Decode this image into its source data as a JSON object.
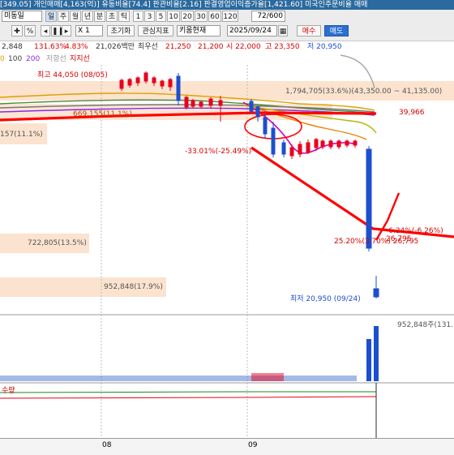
{
  "title_bar": {
    "text": "[349.05] 개인매매[4,163(억)] 유동비율[74.4] 판관비율[2.16] 판결영업이익증가율[1,421.60] 미국인주문비율 매매"
  },
  "toolbar": {
    "row1": {
      "stock_name": "미동일",
      "buttons": [
        "일",
        "주",
        "월",
        "년",
        "분",
        "초",
        "틱",
        "1",
        "3",
        "5",
        "10",
        "20",
        "30",
        "60",
        "120"
      ],
      "count": "72/600"
    },
    "row2": {
      "multiplier": "X 1",
      "reset": "초기화",
      "indicators": "관심지표",
      "status": "키움현재",
      "date": "2025/09/24",
      "buy": "매수",
      "sell": "매도"
    }
  },
  "info_bar": {
    "items": [
      "2,848",
      "131.63%",
      "4.83%",
      "21,026백만",
      "최우선",
      "21,250",
      "21,200",
      "시 22,000",
      "고 23,350",
      "저 20,950"
    ]
  },
  "legend": {
    "ma_100": "100",
    "ma_200": "200",
    "resist": "저항선",
    "support": "지지선"
  },
  "annotations": {
    "high": "최고 44,050 (08/05)",
    "volume_profile_top": "1,794,705(33.6%)(43,350.00 ~ 41,135.00)",
    "profile_left": "669,155(11.1%)",
    "profile_left2": "157(11.1%)",
    "right_price": "39,966",
    "drop_pct": "-33.01%(-25.49%)",
    "rebound": "-6.24%(-6.26%) 26,795",
    "pct_right": "25.20%(3.70%) 26,795",
    "profile_mid": "722,805(13.5%)",
    "profile_low": "952,848(17.9%)",
    "low": "최저 20,950 (09/24)",
    "volume_label": "952,848주(131.",
    "lower_pane": "수량"
  },
  "xaxis": {
    "labels": [
      "08",
      "09"
    ]
  },
  "colors": {
    "up": "#e8001c",
    "down": "#1c4fd0",
    "trend": "#ff0000",
    "volume_profile": "#fbe3cf"
  }
}
